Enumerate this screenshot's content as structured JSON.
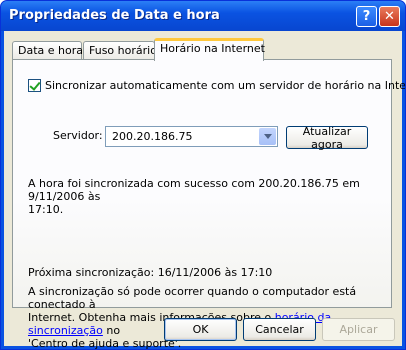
{
  "window": {
    "title": "Propriedades de Data e hora",
    "help_label": "?",
    "close_label": "✕"
  },
  "tabs": [
    {
      "label": "Data e hora",
      "active": false
    },
    {
      "label": "Fuso horário",
      "active": false
    },
    {
      "label": "Horário na Internet",
      "active": true
    }
  ],
  "sync": {
    "checkbox_label": "Sincronizar automaticamente com um servidor de horário na Internet",
    "checked": true,
    "server_label": "Servidor:",
    "server_value": "200.20.186.75",
    "update_button": "Atualizar agora",
    "status_line1": "A hora foi sincronizada com sucesso com 200.20.186.75 em 9/11/2006 às",
    "status_line2": "17:10.",
    "next_sync": "Próxima sincronização: 16/11/2006 às 17:10",
    "info_line1": "A sincronização só pode ocorrer quando o computador está conectado à",
    "info_line2_pre": "Internet. Obtenha mais informações sobre o ",
    "info_link": "horário da sincronização",
    "info_line2_post": " no",
    "info_line3": "'Centro de ajuda e suporte'."
  },
  "footer": {
    "ok": "OK",
    "cancel": "Cancelar",
    "apply": "Aplicar"
  },
  "colors": {
    "titlebar": "#0a53e2",
    "client": "#ece9d8",
    "active_tab_accent": "#ffc83c",
    "link": "#0000ff"
  }
}
